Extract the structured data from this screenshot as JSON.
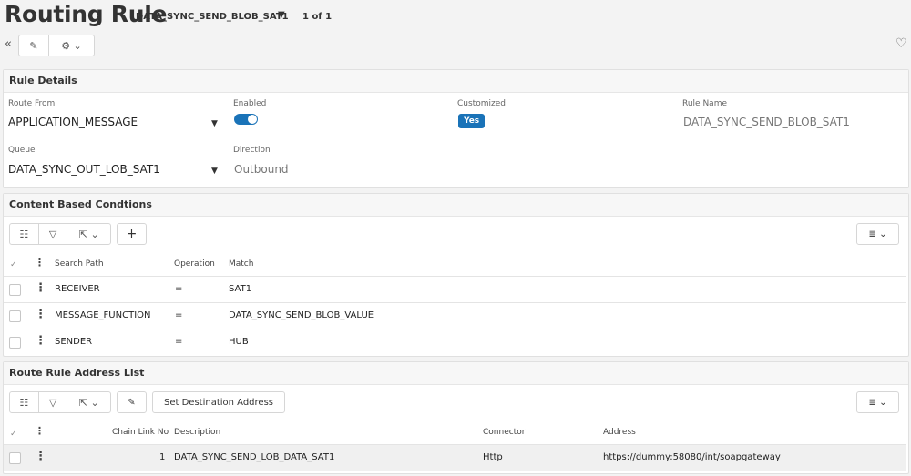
{
  "header": {
    "title": "Routing Rule",
    "record_name": "DATA_SYNC_SEND_BLOB_SAT1",
    "record_count": "1 of 1"
  },
  "toolbar": {
    "collapse": "«",
    "edit": "✎",
    "more": "⚙ ⌄",
    "favorite": "♡"
  },
  "rule_details": {
    "heading": "Rule Details",
    "route_from_label": "Route From",
    "route_from_value": "APPLICATION_MESSAGE",
    "enabled_label": "Enabled",
    "enabled": true,
    "customized_label": "Customized",
    "customized_value": "Yes",
    "rule_name_label": "Rule Name",
    "rule_name_value": "DATA_SYNC_SEND_BLOB_SAT1",
    "queue_label": "Queue",
    "queue_value": "DATA_SYNC_OUT_LOB_SAT1",
    "direction_label": "Direction",
    "direction_value": "Outbound"
  },
  "conditions": {
    "heading": "Content Based Condtions",
    "columns": [
      "Search Path",
      "Operation",
      "Match"
    ],
    "rows": [
      {
        "search_path": "RECEIVER",
        "operation": "=",
        "match": "SAT1"
      },
      {
        "search_path": "MESSAGE_FUNCTION",
        "operation": "=",
        "match": "DATA_SYNC_SEND_BLOB_VALUE"
      },
      {
        "search_path": "SENDER",
        "operation": "=",
        "match": "HUB"
      }
    ]
  },
  "addresses": {
    "heading": "Route Rule Address List",
    "set_destination_label": "Set Destination Address",
    "columns": [
      "Chain Link No",
      "Description",
      "Connector",
      "Address"
    ],
    "rows": [
      {
        "chain_link_no": "1",
        "description": "DATA_SYNC_SEND_LOB_DATA_SAT1",
        "connector": "Http",
        "address": "https://dummy:58080/int/soapgateway"
      }
    ]
  },
  "icons": {
    "list": "☷",
    "filter": "▽",
    "export": "⇱ ⌄",
    "add": "+",
    "edit": "✎",
    "columns": "≣ ⌄",
    "checkall": "✓",
    "kebab": "⋮",
    "caret": "▼"
  }
}
